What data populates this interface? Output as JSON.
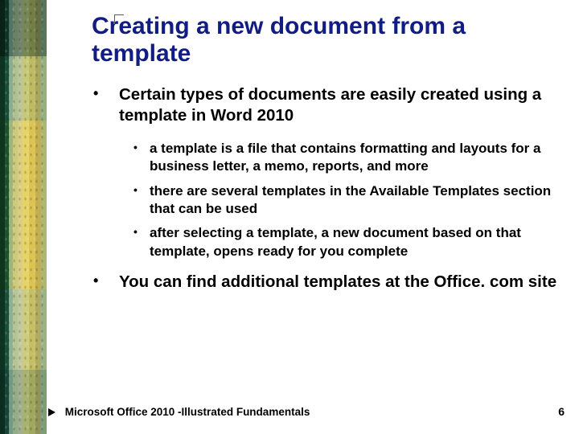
{
  "title": "Creating a new document from a template",
  "bullets": {
    "b1": "Certain types of documents are easily created using a template in Word 2010",
    "sub": {
      "s1": "a template is a file that contains formatting  and layouts for a business letter, a memo, reports, and more",
      "s2": "there are several templates in the Available Templates section that can be used",
      "s3": "after selecting a template, a new document based on that template, opens ready for you complete"
    },
    "b2": "You can find additional templates at the Office. com site"
  },
  "footer": {
    "text": "Microsoft Office 2010 -Illustrated Fundamentals",
    "page": "6"
  }
}
